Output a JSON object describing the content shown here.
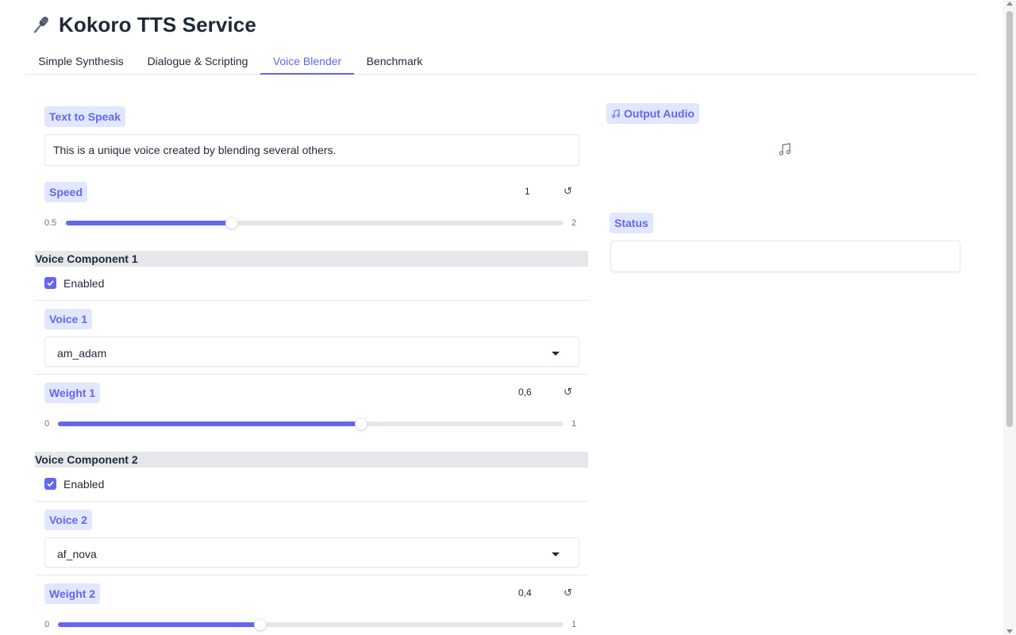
{
  "app": {
    "title": "Kokoro TTS Service",
    "title_icon": "microphone-icon"
  },
  "tabs": [
    {
      "label": "Simple Synthesis",
      "active": false
    },
    {
      "label": "Dialogue & Scripting",
      "active": false
    },
    {
      "label": "Voice Blender",
      "active": true
    },
    {
      "label": "Benchmark",
      "active": false
    }
  ],
  "text_input": {
    "label": "Text to Speak",
    "value": "This is a unique voice created by blending several others."
  },
  "speed": {
    "label": "Speed",
    "value": "1",
    "min": "0.5",
    "max": "2",
    "fill_fraction": 0.333
  },
  "components": [
    {
      "header": "Voice Component 1",
      "enabled_label": "Enabled",
      "enabled": true,
      "voice_label": "Voice 1",
      "voice_value": "am_adam",
      "weight_label": "Weight 1",
      "weight_value": "0,6",
      "weight_min": "0",
      "weight_max": "1",
      "fill_fraction": 0.6
    },
    {
      "header": "Voice Component 2",
      "enabled_label": "Enabled",
      "enabled": true,
      "voice_label": "Voice 2",
      "voice_value": "af_nova",
      "weight_label": "Weight 2",
      "weight_value": "0,4",
      "weight_min": "0",
      "weight_max": "1",
      "fill_fraction": 0.4
    }
  ],
  "output_audio": {
    "label": "Output Audio",
    "icon": "music-note-icon"
  },
  "status": {
    "label": "Status",
    "value": ""
  },
  "colors": {
    "accent": "#6366f1",
    "chip_bg": "#e0e7ff",
    "group_header_bg": "#e5e7eb",
    "page_bg": "#ffffff"
  }
}
